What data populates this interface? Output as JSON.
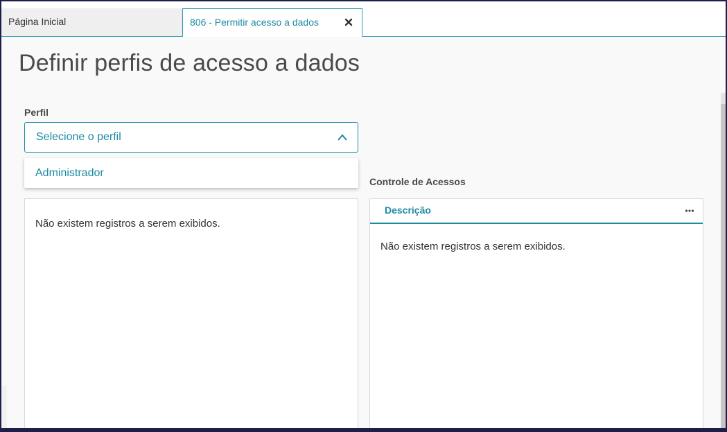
{
  "tabs": {
    "home_label": "Página Inicial",
    "active_label": "806 - Permitir acesso a dados",
    "close_icon": "close-icon"
  },
  "page": {
    "title": "Definir perfis de acesso a dados"
  },
  "profile": {
    "label": "Perfil",
    "placeholder": "Selecione o perfil",
    "toggle_icon": "chevron-up-icon",
    "options": [
      "Administrador"
    ]
  },
  "left_panel": {
    "empty_message": "Não existem registros a serem exibidos."
  },
  "access_control": {
    "title": "Controle de Acessos",
    "columns": [
      "Descrição"
    ],
    "more_icon": "more-icon",
    "empty_message": "Não existem registros a serem exibidos."
  },
  "colors": {
    "accent": "#1c8aa3",
    "frame": "#1b1f4a",
    "background": "#f9f9f9"
  }
}
